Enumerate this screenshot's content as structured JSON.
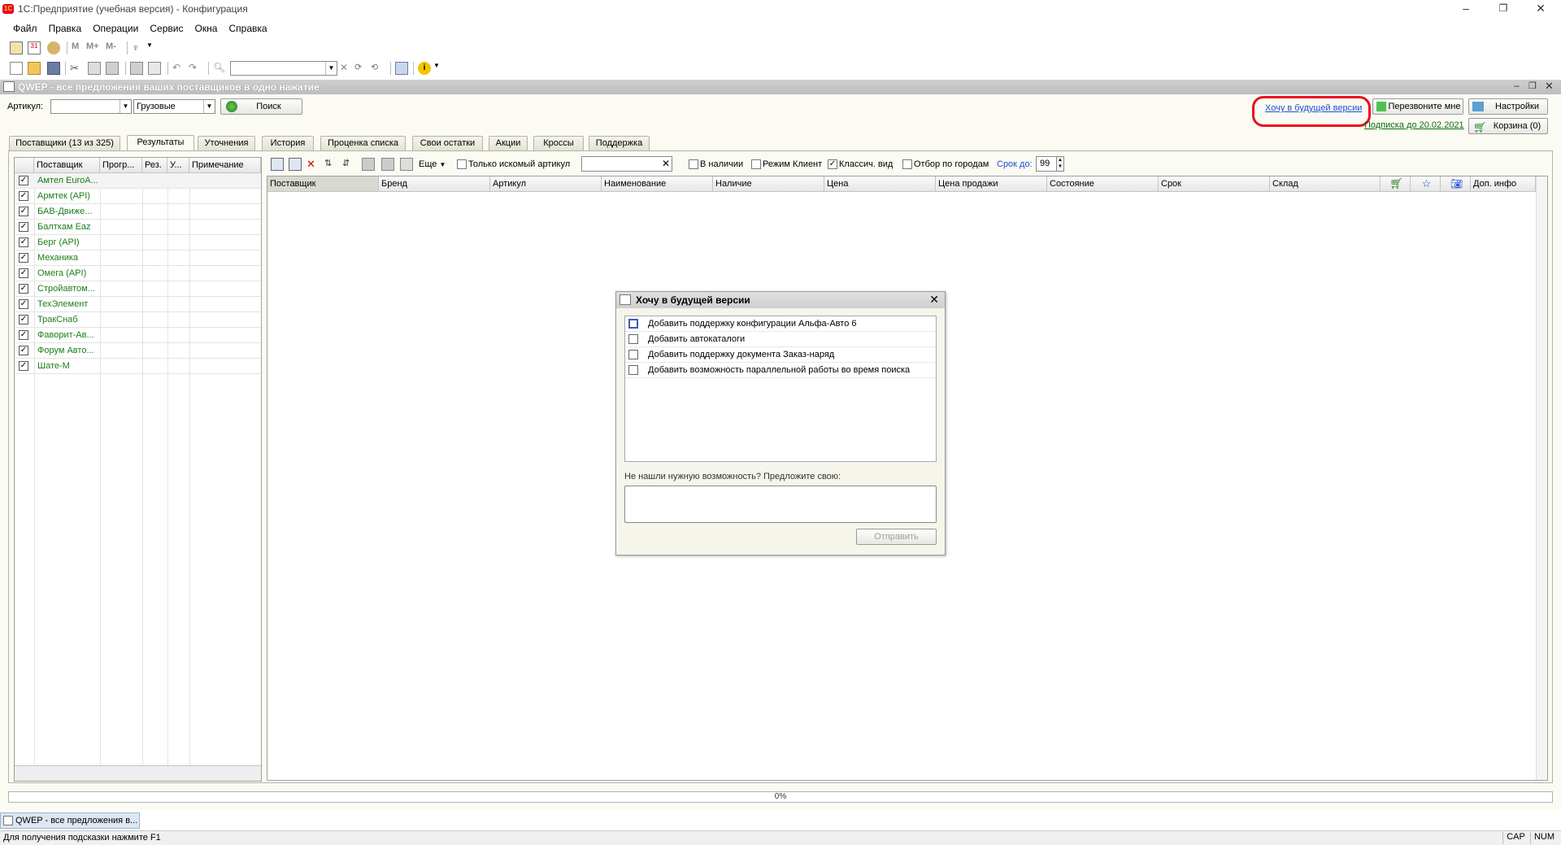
{
  "window": {
    "title": "1С:Предприятие (учебная версия) - Конфигурация",
    "controls": [
      "–",
      "❐",
      "✕"
    ]
  },
  "menu": [
    "Файл",
    "Правка",
    "Операции",
    "Сервис",
    "Окна",
    "Справка"
  ],
  "toolbar1": {
    "labels": [
      "М",
      "М+",
      "М-"
    ]
  },
  "child_window": {
    "title": "QWEP - все предложения ваших поставщиков в одно нажатие"
  },
  "search": {
    "article_label": "Артикул:",
    "article_value": "",
    "category_value": "Грузовые",
    "search_button": "Поиск"
  },
  "right_links": {
    "future_link": "Хочу в будущей версии",
    "call_me": "Перезвоните мне",
    "settings": "Настройки",
    "subscription": "Подписка до 20.02.2021",
    "cart": "Корзина (0)"
  },
  "tabs": [
    {
      "label": "Поставщики (13 из 325)"
    },
    {
      "label": "Результаты"
    },
    {
      "label": "Уточнения"
    },
    {
      "label": "История"
    },
    {
      "label": "Проценка списка"
    },
    {
      "label": "Свои остатки"
    },
    {
      "label": "Акции"
    },
    {
      "label": "Кроссы"
    },
    {
      "label": "Поддержка"
    }
  ],
  "suppliers_table": {
    "headers": [
      "Поставщик",
      "Прогр...",
      "Рез.",
      "У...",
      "Примечание"
    ],
    "rows": [
      "Амтел EuroA...",
      "Армтек (API)",
      "БАВ-Движе...",
      "Балткам Eaz",
      "Берг (API)",
      "Механика",
      "Омега (API)",
      "Стройавтом...",
      "ТехЭлемент",
      "ТракСнаб",
      "Фаворит-Ав...",
      "Форум Авто...",
      "Шате-М"
    ],
    "checkmark": "✓"
  },
  "results_toolbar": {
    "more": "Еще",
    "only_searched": "Только искомый артикул",
    "filter_value": "",
    "in_stock": "В наличии",
    "client_mode": "Режим Клиент",
    "classic_view": "Классич. вид",
    "city_filter": "Отбор по городам",
    "term_label": "Срок до:",
    "term_value": "99"
  },
  "results_table": {
    "headers": [
      "Поставщик",
      "Бренд",
      "Артикул",
      "Наименование",
      "Наличие",
      "Цена",
      "Цена продажи",
      "Состояние",
      "Срок",
      "Склад",
      "",
      "",
      "",
      "Доп. инфо"
    ]
  },
  "dialog": {
    "title": "Хочу в будущей версии",
    "options": [
      "Добавить поддержку конфигурации Альфа-Авто 6",
      "Добавить автокаталоги",
      "Добавить поддержку документа Заказ-наряд",
      "Добавить возможность параллельной работы во время поиска"
    ],
    "suggest_label": "Не нашли нужную возможность? Предложите свою:",
    "suggest_value": "",
    "send_button": "Отправить"
  },
  "progress": "0%",
  "taskbar_item": "QWEP - все предложения в...",
  "status": {
    "hint": "Для получения подсказки нажмите F1",
    "cap": "CAP",
    "num": "NUM"
  },
  "colors": {
    "supplier_text": "#1b7d1b",
    "link": "#1a4fd6",
    "highlight": "#e8101e",
    "panel_bg": "#fbfbf3"
  }
}
